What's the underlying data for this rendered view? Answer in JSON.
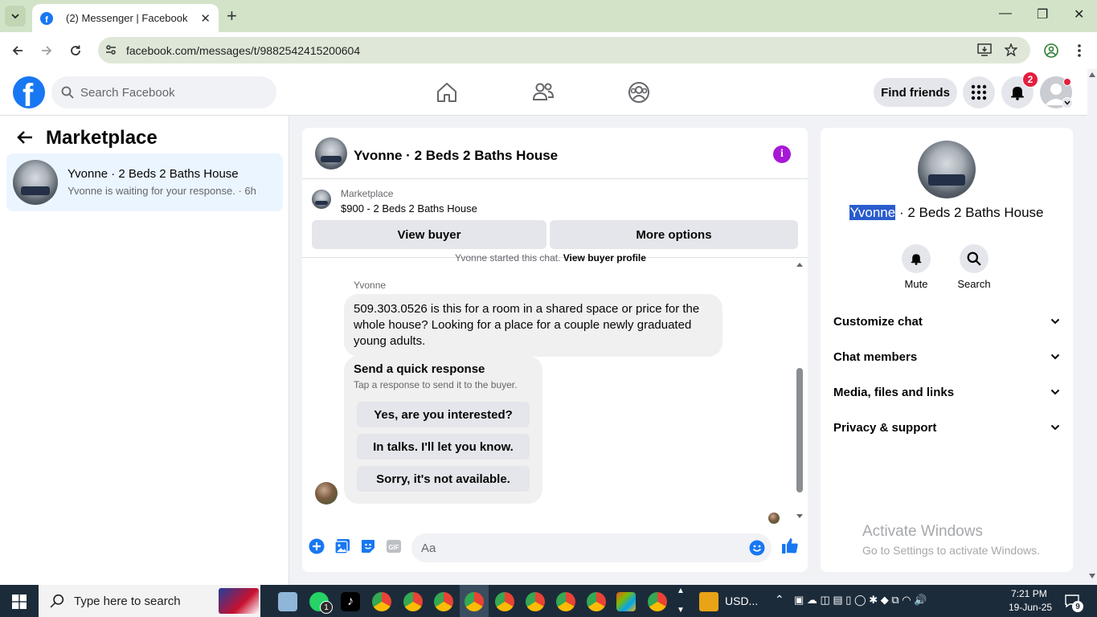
{
  "browser": {
    "tab_title": "(2) Messenger | Facebook",
    "url": "facebook.com/messages/t/9882542415200604"
  },
  "fb": {
    "search_placeholder": "Search Facebook",
    "find_friends": "Find friends",
    "notification_count": "2"
  },
  "left": {
    "title": "Marketplace",
    "conversation": {
      "title": "Yvonne · 2 Beds 2 Baths House",
      "subtitle": "Yvonne is waiting for your response. · 6h"
    }
  },
  "chat": {
    "title": "Yvonne · 2 Beds 2 Baths House",
    "marketplace_label": "Marketplace",
    "listing": "$900 - 2 Beds 2 Baths House",
    "view_buyer": "View buyer",
    "more_options": "More options",
    "started_text": "Yvonne started this chat.",
    "view_buyer_profile": "View buyer profile",
    "sender": "Yvonne",
    "message": "509.303.0526 is this for a room in a shared space or price for the whole house? Looking for a place for a couple newly graduated young adults.",
    "quick_title": "Send a quick response",
    "quick_sub": "Tap a response to send it to the buyer.",
    "quick_replies": [
      "Yes, are you interested?",
      "In talks. I'll let you know.",
      "Sorry, it's not available."
    ],
    "composer_placeholder": "Aa"
  },
  "right": {
    "name_highlight": "Yvonne",
    "name_rest": " · 2 Beds 2 Baths House",
    "mute": "Mute",
    "search": "Search",
    "sections": [
      "Customize chat",
      "Chat members",
      "Media, files and links",
      "Privacy & support"
    ],
    "activate_title": "Activate Windows",
    "activate_sub": "Go to Settings to activate Windows."
  },
  "taskbar": {
    "search_placeholder": "Type here to search",
    "currency": "USD...",
    "time": "7:21 PM",
    "date": "19-Jun-25",
    "whatsapp_badge": "1",
    "notif_count": "9"
  },
  "colors": {
    "fb_blue": "#1877f2",
    "messenger_purple": "#a61ad6",
    "selection": "#2a5ccd"
  }
}
